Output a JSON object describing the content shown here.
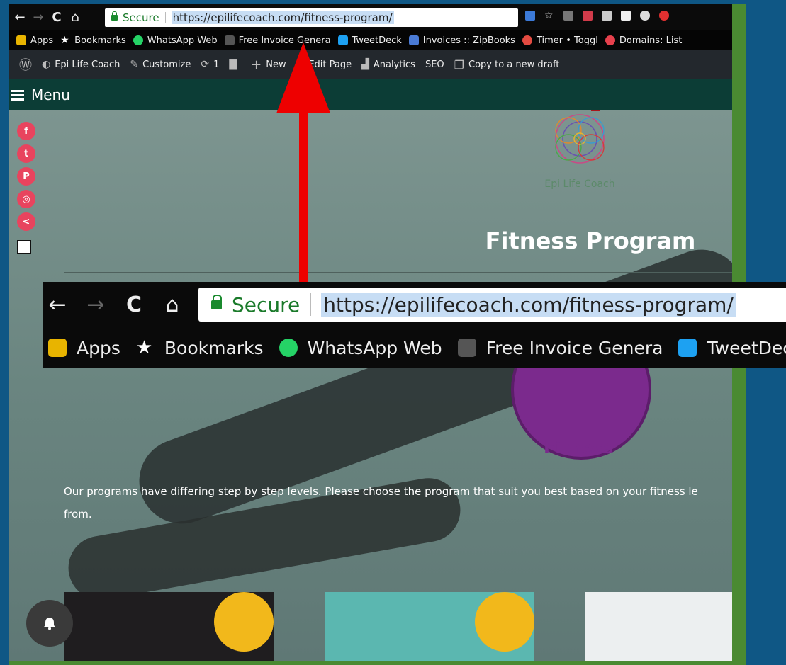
{
  "browser": {
    "url_secure_label": "Secure",
    "url": "https://epilifecoach.com/fitness-program/",
    "nav": {
      "back": "←",
      "forward": "→",
      "reload": "C",
      "home": "⌂"
    }
  },
  "bookmarks": [
    {
      "label": "Apps",
      "icon": "apps-grid-icon",
      "color": "#e8b400"
    },
    {
      "label": "Bookmarks",
      "icon": "star-icon",
      "color": "#ffffff"
    },
    {
      "label": "WhatsApp Web",
      "icon": "whatsapp-icon",
      "color": "#25d366"
    },
    {
      "label": "Free Invoice Genera",
      "icon": "invoice-icon",
      "color": "#888888"
    },
    {
      "label": "TweetDeck",
      "icon": "tweetdeck-icon",
      "color": "#1da1f2"
    },
    {
      "label": "Invoices :: ZipBooks",
      "icon": "zipbooks-icon",
      "color": "#4a7bd6"
    },
    {
      "label": "Timer • Toggl",
      "icon": "toggl-icon",
      "color": "#e44b41"
    },
    {
      "label": "Domains: List",
      "icon": "domains-icon",
      "color": "#e6404c"
    }
  ],
  "admin_bar": [
    {
      "label": "",
      "icon": "wordpress-icon",
      "glyph": "Ⓦ"
    },
    {
      "label": "Epi Life Coach",
      "icon": "dashboard-icon",
      "glyph": "◐"
    },
    {
      "label": "Customize",
      "icon": "brush-icon",
      "glyph": "✎"
    },
    {
      "label": "1",
      "icon": "updates-icon",
      "glyph": "⟳"
    },
    {
      "label": "",
      "icon": "comments-icon",
      "glyph": "▇"
    },
    {
      "label": "New",
      "icon": "plus-icon",
      "glyph": "+"
    },
    {
      "label": "Edit Page",
      "icon": "pencil-icon",
      "glyph": "✐"
    },
    {
      "label": "Analytics",
      "icon": "analytics-icon",
      "glyph": "▟"
    },
    {
      "label": "SEO",
      "icon": "seo-icon",
      "glyph": ""
    },
    {
      "label": "Copy to a new draft",
      "icon": "copy-icon",
      "glyph": "❐"
    }
  ],
  "site": {
    "menu_label": "Menu",
    "logo_text": "Epi Life Coach",
    "page_title": "Fitness Program",
    "fitness_label": "Fitness",
    "description_line1": "Our programs have differing step by step levels. Please choose the program that suit you best based on your fitness le",
    "description_line2": "from."
  },
  "social": [
    {
      "icon": "facebook-icon",
      "glyph": "f"
    },
    {
      "icon": "twitter-icon",
      "glyph": "t"
    },
    {
      "icon": "pinterest-icon",
      "glyph": "P"
    },
    {
      "icon": "instagram-icon",
      "glyph": "◎"
    },
    {
      "icon": "share-icon",
      "glyph": "<"
    }
  ],
  "zoom_bookmarks": [
    {
      "label": "Apps",
      "icon": "apps-grid-icon",
      "color": "#e8b400"
    },
    {
      "label": "Bookmarks",
      "icon": "star-icon",
      "color": "#ffffff"
    },
    {
      "label": "WhatsApp Web",
      "icon": "whatsapp-icon",
      "color": "#25d366"
    },
    {
      "label": "Free Invoice Genera",
      "icon": "invoice-icon",
      "color": "#888888"
    },
    {
      "label": "TweetDeck",
      "icon": "tweetdeck-icon",
      "color": "#1da1f2"
    }
  ],
  "colors": {
    "accent_red": "#ee0000",
    "outer_bg": "#0f5785",
    "frame_green": "#4a8a32"
  }
}
